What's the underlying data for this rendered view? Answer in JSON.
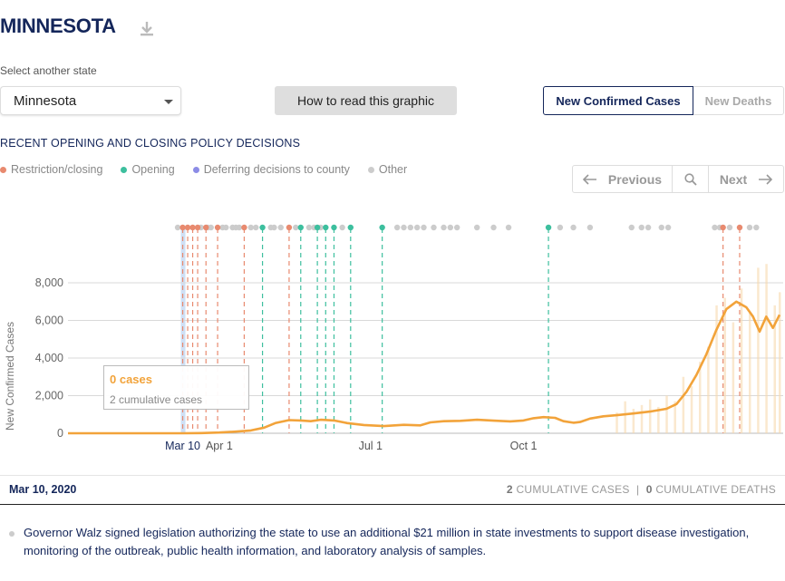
{
  "header": {
    "title": "MINNESOTA",
    "download_icon": "download-icon"
  },
  "state_select": {
    "label": "Select another state",
    "value": "Minnesota"
  },
  "how_button": {
    "label": "How to read this graphic"
  },
  "toggles": {
    "active": "New Confirmed Cases",
    "inactive": "New Deaths"
  },
  "policy": {
    "title": "RECENT OPENING AND CLOSING POLICY DECISIONS",
    "legend": [
      {
        "label": "Restriction/closing",
        "color": "#e88a6f"
      },
      {
        "label": "Opening",
        "color": "#3dbf9e"
      },
      {
        "label": "Deferring decisions to county",
        "color": "#8c8ce6"
      },
      {
        "label": "Other",
        "color": "#cccccc"
      }
    ]
  },
  "nav": {
    "previous": "Previous",
    "next": "Next"
  },
  "tooltip": {
    "main": "0 cases",
    "sub": "2 cumulative cases"
  },
  "status": {
    "date": "Mar 10, 2020",
    "cases_num": "2",
    "cases_label": "CUMULATIVE CASES",
    "separator": "|",
    "deaths_num": "0",
    "deaths_label": "CUMULATIVE DEATHS"
  },
  "description": "Governor Walz signed legislation authorizing the state to use an additional $21 million in state investments to support disease investigation, monitoring of the outbreak, public health information, and laboratory analysis of samples.",
  "chart_data": {
    "type": "line",
    "title": "",
    "xlabel": "",
    "ylabel": "New Confirmed Cases",
    "ylim": [
      0,
      8000
    ],
    "yticks": [
      0,
      2000,
      4000,
      6000,
      8000
    ],
    "ytick_labels": [
      "0",
      "2,000",
      "4,000",
      "6,000",
      "8,000"
    ],
    "x_ticks": [
      {
        "label": "Mar 10",
        "day": 69,
        "highlight": true
      },
      {
        "label": "Apr 1",
        "day": 91,
        "highlight": false
      },
      {
        "label": "Jul 1",
        "day": 182,
        "highlight": false
      },
      {
        "label": "Oct 1",
        "day": 274,
        "highlight": false
      }
    ],
    "series": [
      {
        "color": "#f2a33a",
        "points": [
          [
            0,
            0
          ],
          [
            69,
            0
          ],
          [
            80,
            10
          ],
          [
            91,
            40
          ],
          [
            100,
            80
          ],
          [
            110,
            150
          ],
          [
            118,
            300
          ],
          [
            125,
            550
          ],
          [
            133,
            700
          ],
          [
            140,
            680
          ],
          [
            146,
            640
          ],
          [
            152,
            720
          ],
          [
            160,
            680
          ],
          [
            168,
            540
          ],
          [
            178,
            440
          ],
          [
            190,
            380
          ],
          [
            202,
            450
          ],
          [
            212,
            420
          ],
          [
            218,
            580
          ],
          [
            226,
            640
          ],
          [
            236,
            660
          ],
          [
            246,
            720
          ],
          [
            256,
            670
          ],
          [
            266,
            630
          ],
          [
            274,
            680
          ],
          [
            280,
            800
          ],
          [
            286,
            860
          ],
          [
            293,
            820
          ],
          [
            298,
            640
          ],
          [
            304,
            560
          ],
          [
            308,
            600
          ],
          [
            314,
            780
          ],
          [
            322,
            900
          ],
          [
            330,
            960
          ],
          [
            340,
            1050
          ],
          [
            350,
            1150
          ],
          [
            360,
            1300
          ],
          [
            366,
            1550
          ],
          [
            372,
            2200
          ],
          [
            378,
            3100
          ],
          [
            384,
            4200
          ],
          [
            390,
            5500
          ],
          [
            396,
            6600
          ],
          [
            402,
            7000
          ],
          [
            408,
            6700
          ],
          [
            412,
            6200
          ],
          [
            416,
            5400
          ],
          [
            420,
            6200
          ],
          [
            424,
            5600
          ],
          [
            428,
            6300
          ]
        ]
      }
    ],
    "daily_bars": [
      [
        330,
        1100
      ],
      [
        335,
        1700
      ],
      [
        340,
        1300
      ],
      [
        345,
        1500
      ],
      [
        350,
        1800
      ],
      [
        355,
        1400
      ],
      [
        360,
        2000
      ],
      [
        365,
        1700
      ],
      [
        370,
        3000
      ],
      [
        375,
        2500
      ],
      [
        380,
        3800
      ],
      [
        385,
        4600
      ],
      [
        390,
        6800
      ],
      [
        395,
        7200
      ],
      [
        400,
        5900
      ],
      [
        405,
        7700
      ],
      [
        410,
        6400
      ],
      [
        415,
        8800
      ],
      [
        420,
        9000
      ],
      [
        425,
        6800
      ],
      [
        428,
        7500
      ]
    ],
    "policy_events": [
      {
        "day": 69,
        "type": "restriction"
      },
      {
        "day": 72,
        "type": "restriction"
      },
      {
        "day": 75,
        "type": "restriction"
      },
      {
        "day": 78,
        "type": "restriction"
      },
      {
        "day": 83,
        "type": "restriction"
      },
      {
        "day": 90,
        "type": "restriction"
      },
      {
        "day": 106,
        "type": "restriction"
      },
      {
        "day": 117,
        "type": "opening"
      },
      {
        "day": 133,
        "type": "restriction"
      },
      {
        "day": 140,
        "type": "opening"
      },
      {
        "day": 150,
        "type": "opening"
      },
      {
        "day": 155,
        "type": "opening"
      },
      {
        "day": 160,
        "type": "opening"
      },
      {
        "day": 170,
        "type": "opening"
      },
      {
        "day": 189,
        "type": "opening"
      },
      {
        "day": 289,
        "type": "opening"
      },
      {
        "day": 394,
        "type": "restriction"
      },
      {
        "day": 404,
        "type": "restriction"
      }
    ],
    "other_events": [
      66,
      80,
      84,
      86,
      93,
      95,
      99,
      101,
      103,
      110,
      113,
      122,
      124,
      128,
      137,
      145,
      148,
      152,
      165,
      198,
      202,
      206,
      210,
      214,
      220,
      226,
      230,
      234,
      246,
      256,
      265,
      296,
      304,
      314,
      339,
      345,
      349,
      357,
      361,
      389,
      392,
      398,
      410,
      414
    ]
  }
}
